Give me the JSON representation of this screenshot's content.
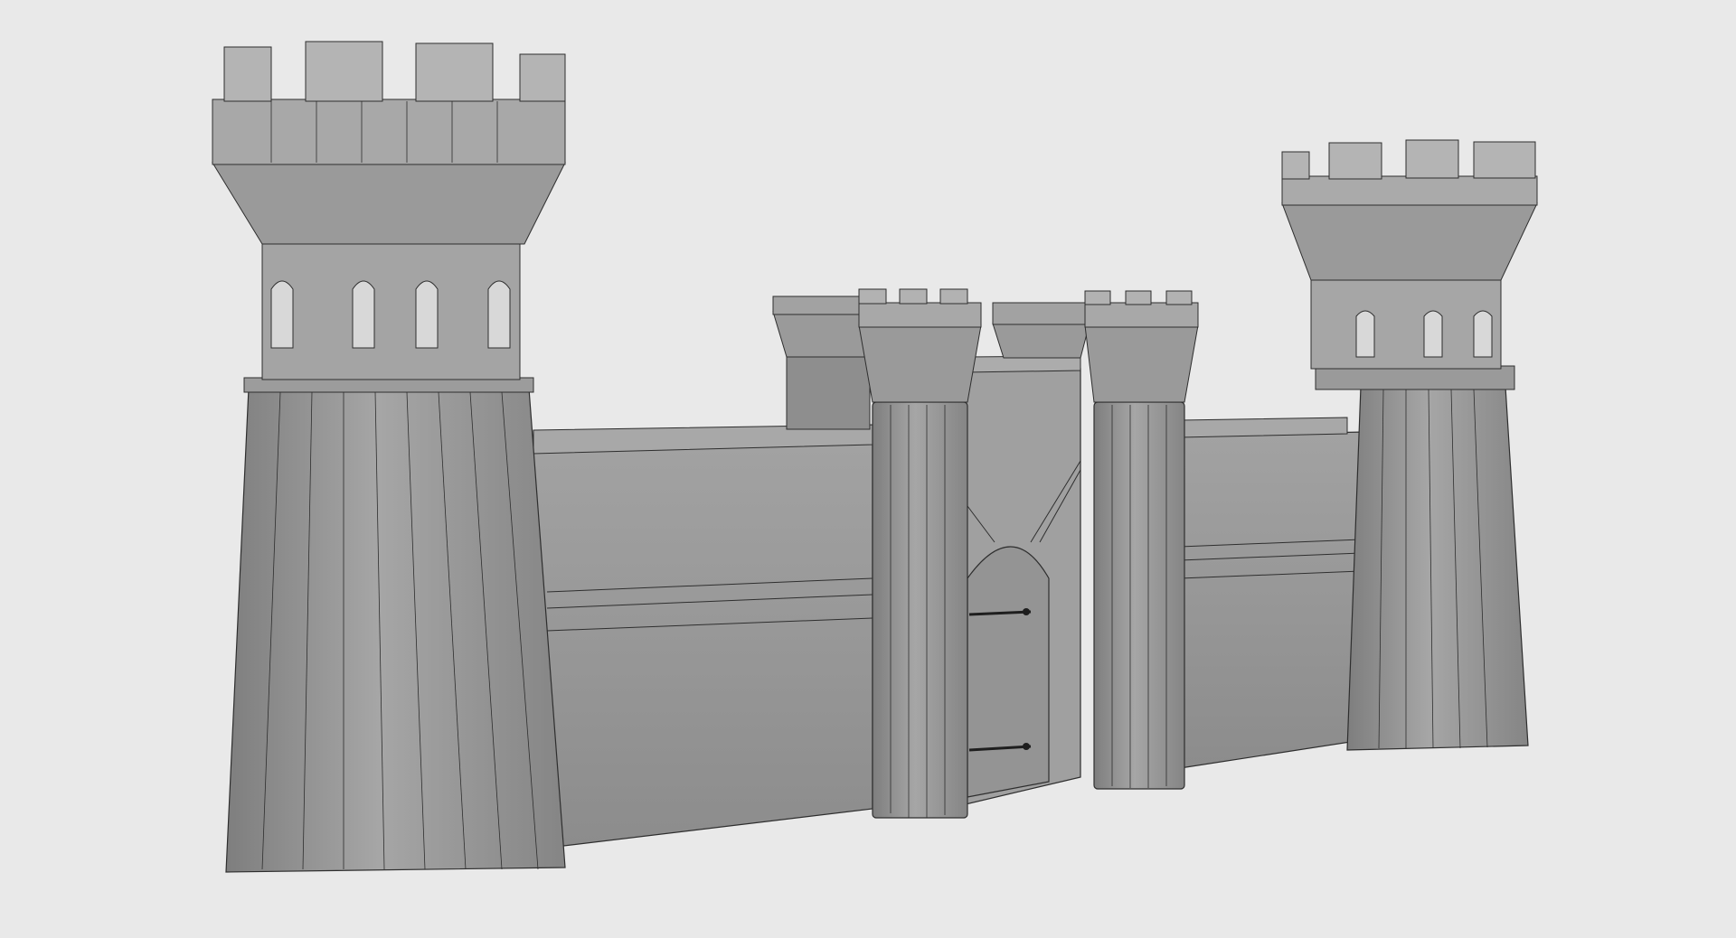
{
  "scene": {
    "subject": "castle-gatehouse-wireframe-render",
    "colors": {
      "background": "#e9e9e9",
      "tower_light": "#a4a4a4",
      "tower_mid": "#8e8e8e",
      "tower_dark": "#7a7a7a",
      "wall_light": "#9c9c9c",
      "wall_lower": "#8c8c8c",
      "wire": "#2e2e2e",
      "window_opening": "#d8d8d8",
      "hinge": "#1e1e1e"
    }
  }
}
